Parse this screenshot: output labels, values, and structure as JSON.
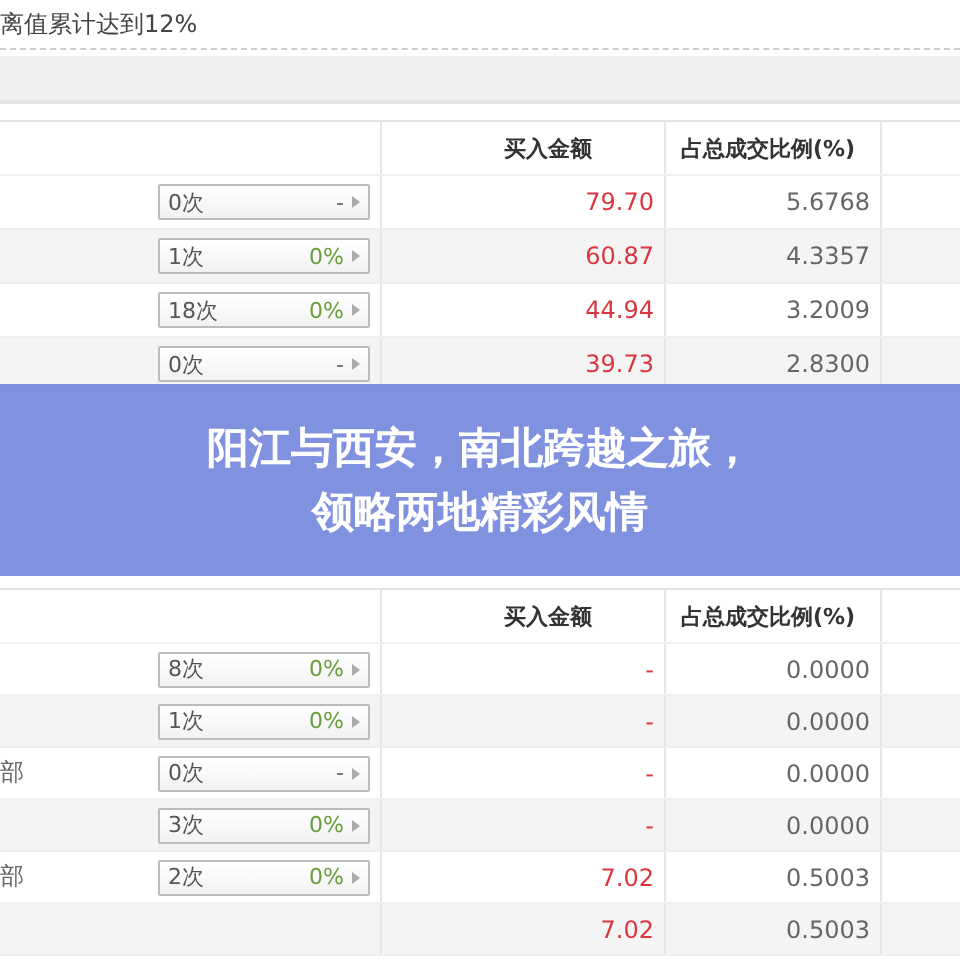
{
  "note": "离值累计达到12%",
  "tables": [
    {
      "columns": [
        "买入金额",
        "占总成交比例(%)"
      ],
      "rows": [
        {
          "count": "0次",
          "change": "-",
          "amount": "79.70",
          "ratio": "5.6768"
        },
        {
          "count": "1次",
          "change": "0%",
          "amount": "60.87",
          "ratio": "4.3357"
        },
        {
          "count": "18次",
          "change": "0%",
          "amount": "44.94",
          "ratio": "3.2009"
        },
        {
          "count": "0次",
          "change": "-",
          "amount": "39.73",
          "ratio": "2.8300"
        }
      ]
    },
    {
      "columns": [
        "买入金额",
        "占总成交比例(%)"
      ],
      "rows": [
        {
          "count": "8次",
          "change": "0%",
          "amount": "-",
          "ratio": "0.0000"
        },
        {
          "count": "1次",
          "change": "0%",
          "amount": "-",
          "ratio": "0.0000"
        },
        {
          "name": "部",
          "count": "0次",
          "change": "-",
          "amount": "-",
          "ratio": "0.0000"
        },
        {
          "count": "3次",
          "change": "0%",
          "amount": "-",
          "ratio": "0.0000"
        },
        {
          "name": "部",
          "count": "2次",
          "change": "0%",
          "amount": "7.02",
          "ratio": "0.5003"
        },
        {
          "amount": "7.02",
          "ratio": "0.5003"
        }
      ]
    }
  ],
  "banner": {
    "lines": [
      "阳江与西安，南北跨越之旅，",
      "领略两地精彩风情"
    ]
  }
}
